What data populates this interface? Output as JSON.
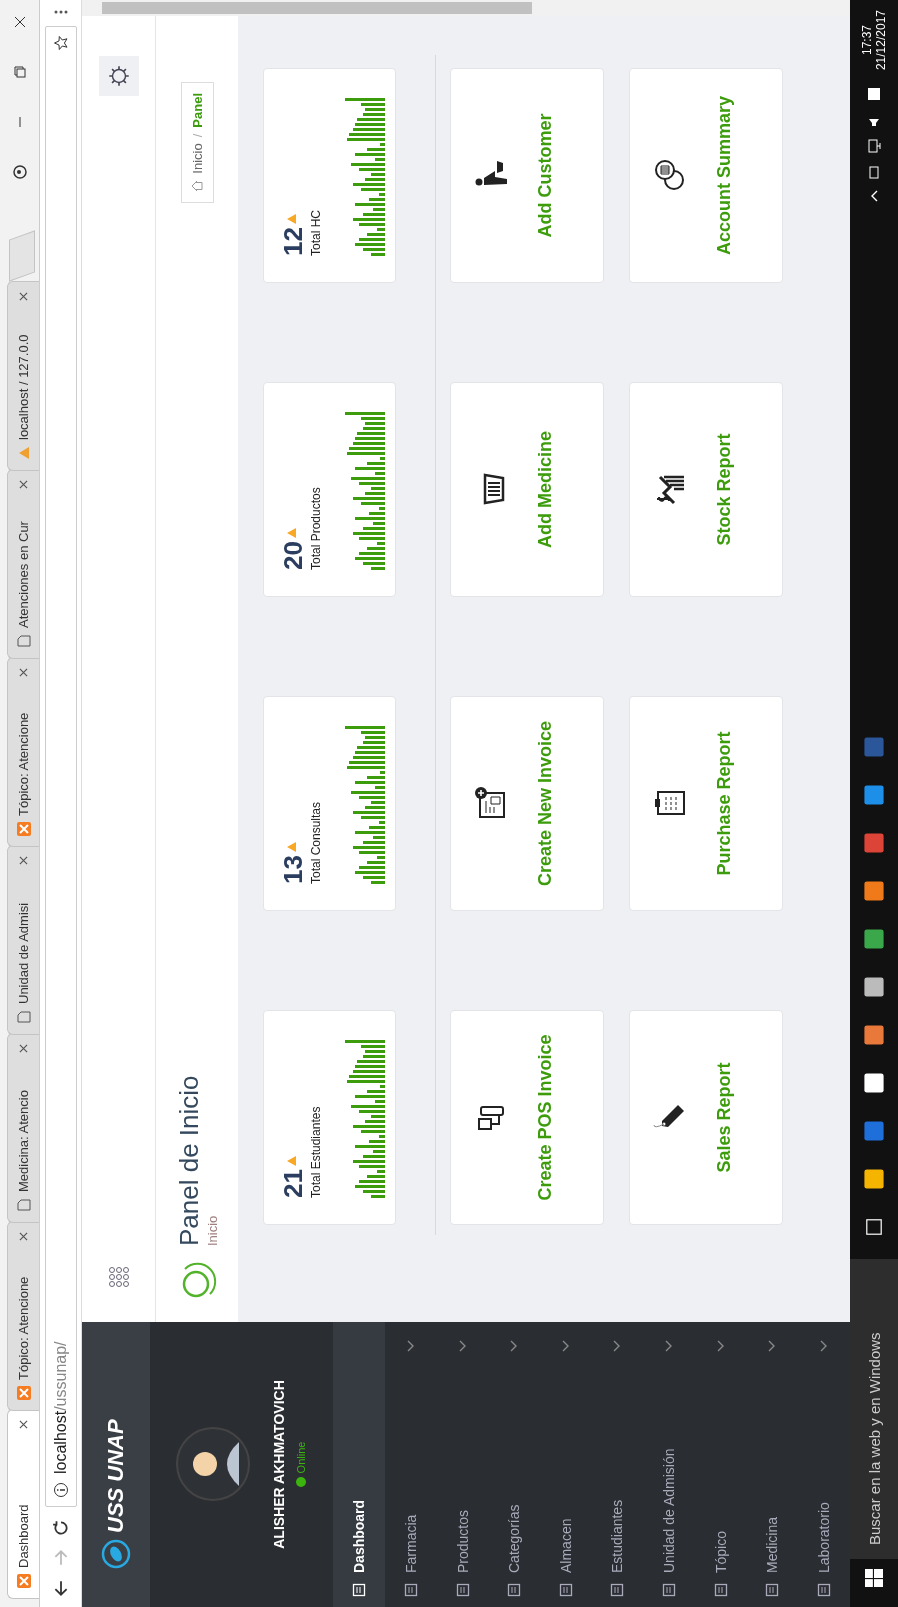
{
  "browser": {
    "tabs": [
      {
        "title": "Dashboard",
        "kind": "xampp",
        "selected": true
      },
      {
        "title": "Tópico: Atencione",
        "kind": "xampp",
        "selected": false
      },
      {
        "title": "Medicina: Atencio",
        "kind": "page",
        "selected": false
      },
      {
        "title": "Unidad de Admisi",
        "kind": "page",
        "selected": false
      },
      {
        "title": "Tópico: Atencione",
        "kind": "xampp",
        "selected": false
      },
      {
        "title": "Atenciones en Cur",
        "kind": "page",
        "selected": false
      },
      {
        "title": "localhost / 127.0.0",
        "kind": "pma",
        "selected": false
      }
    ],
    "url_host": "localhost",
    "url_path": "/ussunap/"
  },
  "sidebar": {
    "brand": "USS UNAP",
    "user": {
      "name": "ALISHER AKHMATOVICH",
      "status": "Online"
    },
    "items": [
      {
        "label": "Dashboard",
        "selected": true,
        "has_children": false
      },
      {
        "label": "Farmacia",
        "selected": false,
        "has_children": true
      },
      {
        "label": "Productos",
        "selected": false,
        "has_children": true
      },
      {
        "label": "Categorías",
        "selected": false,
        "has_children": true
      },
      {
        "label": "Almacen",
        "selected": false,
        "has_children": true
      },
      {
        "label": "Estudiantes",
        "selected": false,
        "has_children": true
      },
      {
        "label": "Unidad de Admisión",
        "selected": false,
        "has_children": true
      },
      {
        "label": "Tópico",
        "selected": false,
        "has_children": true
      },
      {
        "label": "Medicina",
        "selected": false,
        "has_children": true
      },
      {
        "label": "Laboratorio",
        "selected": false,
        "has_children": true
      }
    ]
  },
  "header": {
    "title": "Panel de Inicio",
    "subtitle": "Inicio",
    "separator": "/",
    "breadcrumb": [
      {
        "label": "Inicio",
        "selected": false
      },
      {
        "label": "Panel",
        "selected": true
      }
    ]
  },
  "stats": [
    {
      "value": "21",
      "label": "Total Estudiantes"
    },
    {
      "value": "13",
      "label": "Total Consultas"
    },
    {
      "value": "20",
      "label": "Total Productos"
    },
    {
      "value": "12",
      "label": "Total HC"
    }
  ],
  "actions": [
    {
      "label": "Create POS Invoice",
      "kind": "pos"
    },
    {
      "label": "Create New Invoice",
      "kind": "invoice"
    },
    {
      "label": "Add Medicine",
      "kind": "basket"
    },
    {
      "label": "Add Customer",
      "kind": "customer"
    },
    {
      "label": "Sales Report",
      "kind": "tag"
    },
    {
      "label": "Purchase Report",
      "kind": "clipboard"
    },
    {
      "label": "Stock Report",
      "kind": "stock"
    },
    {
      "label": "Account Summary",
      "kind": "coins"
    }
  ],
  "taskbar": {
    "search_placeholder": "Buscar en la web y en Windows",
    "time": "17:37",
    "date": "21/12/2017"
  }
}
